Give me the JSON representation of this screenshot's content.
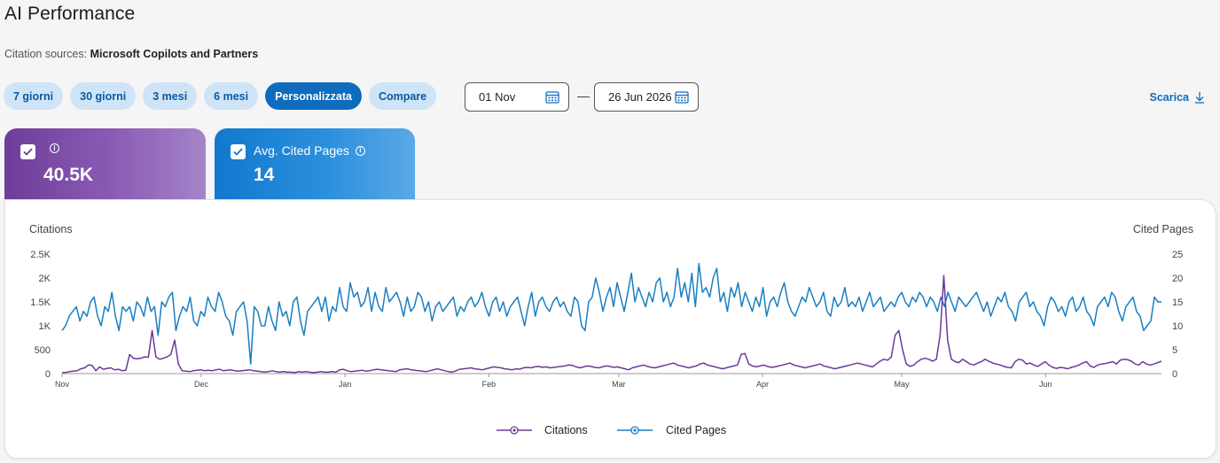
{
  "header": {
    "title": "AI Performance",
    "sources_label": "Citation sources:",
    "sources_value": "Microsoft Copilots and Partners"
  },
  "ranges": [
    {
      "label": "7 giorni",
      "active": false
    },
    {
      "label": "30 giorni",
      "active": false
    },
    {
      "label": "3 mesi",
      "active": false
    },
    {
      "label": "6 mesi",
      "active": false
    },
    {
      "label": "Personalizzata",
      "active": true
    },
    {
      "label": "Compare",
      "active": false
    }
  ],
  "dates": {
    "start": "01 Nov",
    "end": "26 Jun 2026",
    "separator": "—"
  },
  "download_label": "Scarica",
  "cards": [
    {
      "label": "",
      "value": "40.5K",
      "checked": true,
      "color": "#7b4aa6"
    },
    {
      "label": "Avg. Cited Pages",
      "value": "14",
      "checked": true,
      "color": "#1a80d3"
    }
  ],
  "colors": {
    "citations": "#6b3a98",
    "cited_pages": "#1a7fc2",
    "accent": "#0f6cbd"
  },
  "chart_data": {
    "type": "line",
    "ylabel_left": "Citations",
    "ylabel_right": "Cited Pages",
    "y_left_ticks": [
      "0",
      "500",
      "1K",
      "1.5K",
      "2K",
      "2.5K"
    ],
    "y_right_ticks": [
      "0",
      "5",
      "10",
      "15",
      "20",
      "25"
    ],
    "ylim_left": [
      0,
      2500
    ],
    "ylim_right": [
      0,
      25
    ],
    "x_range": [
      "2025-11-01",
      "2026-06-26"
    ],
    "month_labels": [
      "Nov",
      "Dec",
      "Jan",
      "Feb",
      "Mar",
      "Apr",
      "May",
      "Jun"
    ],
    "legend": [
      "Citations",
      "Cited Pages"
    ],
    "legend_position": "bottom-center",
    "series": [
      {
        "name": "Citations",
        "axis": "left",
        "values": [
          20,
          25,
          40,
          50,
          60,
          100,
          120,
          180,
          170,
          60,
          140,
          90,
          110,
          120,
          80,
          90,
          60,
          70,
          400,
          320,
          310,
          320,
          350,
          340,
          900,
          350,
          300,
          320,
          350,
          400,
          700,
          200,
          60,
          50,
          40,
          60,
          70,
          80,
          60,
          70,
          60,
          80,
          90,
          60,
          70,
          80,
          60,
          50,
          60,
          70,
          80,
          60,
          50,
          40,
          30,
          40,
          60,
          40,
          30,
          40,
          30,
          30,
          20,
          40,
          30,
          40,
          30,
          20,
          30,
          40,
          30,
          30,
          40,
          30,
          80,
          90,
          60,
          40,
          50,
          60,
          70,
          50,
          60,
          80,
          90,
          80,
          70,
          60,
          50,
          40,
          80,
          90,
          100,
          80,
          70,
          60,
          50,
          40,
          60,
          80,
          100,
          80,
          60,
          40,
          30,
          60,
          90,
          100,
          110,
          120,
          100,
          90,
          80,
          100,
          120,
          140,
          130,
          120,
          100,
          90,
          80,
          100,
          90,
          120,
          130,
          120,
          140,
          150,
          130,
          140,
          120,
          130,
          140,
          150,
          160,
          180,
          170,
          140,
          120,
          140,
          160,
          150,
          130,
          120,
          140,
          160,
          150,
          130,
          140,
          120,
          100,
          80,
          120,
          140,
          160,
          180,
          150,
          130,
          120,
          140,
          160,
          180,
          200,
          220,
          180,
          160,
          140,
          120,
          140,
          160,
          200,
          220,
          180,
          160,
          140,
          120,
          100,
          120,
          140,
          160,
          180,
          400,
          420,
          200,
          160,
          140,
          160,
          180,
          150,
          130,
          140,
          160,
          180,
          200,
          220,
          180,
          160,
          140,
          120,
          140,
          160,
          180,
          200,
          160,
          140,
          120,
          100,
          120,
          140,
          160,
          180,
          200,
          220,
          200,
          180,
          160,
          140,
          200,
          260,
          300,
          280,
          350,
          800,
          900,
          500,
          200,
          150,
          180,
          250,
          300,
          320,
          300,
          260,
          300,
          800,
          2050,
          700,
          300,
          250,
          230,
          300,
          250,
          200,
          180,
          220,
          250,
          300,
          260,
          220,
          200,
          180,
          150,
          130,
          120,
          250,
          300,
          280,
          200,
          220,
          180,
          150,
          200,
          250,
          180,
          130,
          110,
          130,
          120,
          100,
          130,
          150,
          180,
          220,
          250,
          160,
          130,
          180,
          200,
          210,
          230,
          250,
          200,
          280,
          300,
          290,
          260,
          200,
          180,
          250,
          200,
          180,
          200,
          230,
          260
        ],
        "color": "#6b3a98"
      },
      {
        "name": "Cited Pages",
        "axis": "right",
        "values": [
          9,
          10,
          12,
          13,
          14,
          11,
          13,
          12,
          15,
          16,
          12,
          10,
          14,
          13,
          17,
          12,
          9,
          14,
          13,
          14,
          11,
          15,
          14,
          12,
          16,
          13,
          14,
          8,
          15,
          14,
          16,
          17,
          9,
          12,
          14,
          13,
          16,
          11,
          10,
          13,
          12,
          16,
          14,
          13,
          17,
          15,
          12,
          11,
          8,
          13,
          14,
          15,
          11,
          2,
          14,
          13,
          10,
          10,
          14,
          11,
          9,
          15,
          12,
          13,
          10,
          15,
          16,
          11,
          8,
          13,
          14,
          15,
          16,
          13,
          16,
          11,
          14,
          13,
          18,
          14,
          13,
          19,
          16,
          17,
          14,
          15,
          18,
          13,
          17,
          14,
          13,
          18,
          15,
          16,
          17,
          15,
          12,
          16,
          13,
          14,
          17,
          16,
          13,
          15,
          11,
          14,
          15,
          13,
          14,
          15,
          16,
          12,
          14,
          13,
          15,
          16,
          14,
          15,
          17,
          14,
          12,
          15,
          16,
          13,
          15,
          12,
          14,
          15,
          16,
          13,
          10,
          14,
          17,
          12,
          15,
          16,
          14,
          13,
          15,
          16,
          14,
          15,
          13,
          12,
          16,
          15,
          10,
          9,
          15,
          16,
          20,
          17,
          13,
          16,
          18,
          14,
          19,
          16,
          13,
          17,
          21,
          15,
          18,
          16,
          14,
          17,
          15,
          19,
          20,
          15,
          17,
          14,
          16,
          22,
          16,
          19,
          15,
          21,
          14,
          23,
          17,
          18,
          16,
          20,
          22,
          15,
          17,
          13,
          18,
          16,
          19,
          14,
          17,
          15,
          13,
          16,
          14,
          18,
          12,
          15,
          16,
          14,
          17,
          19,
          15,
          13,
          12,
          14,
          16,
          15,
          18,
          16,
          14,
          15,
          17,
          13,
          12,
          16,
          14,
          15,
          18,
          14,
          15,
          14,
          16,
          13,
          15,
          17,
          14,
          15,
          16,
          13,
          14,
          15,
          14,
          16,
          17,
          15,
          14,
          16,
          15,
          17,
          16,
          14,
          16,
          15,
          13,
          16,
          14,
          17,
          15,
          13,
          16,
          15,
          14,
          15,
          16,
          17,
          15,
          13,
          15,
          12,
          14,
          16,
          15,
          17,
          14,
          13,
          11,
          15,
          16,
          17,
          14,
          15,
          13,
          12,
          10,
          14,
          16,
          15,
          13,
          14,
          12,
          15,
          16,
          13,
          14,
          16,
          13,
          12,
          10,
          14,
          15,
          16,
          14,
          17,
          16,
          13,
          11,
          14,
          15,
          16,
          13,
          12,
          9,
          10,
          11,
          16,
          15,
          15
        ],
        "color": "#1a7fc2"
      }
    ]
  }
}
